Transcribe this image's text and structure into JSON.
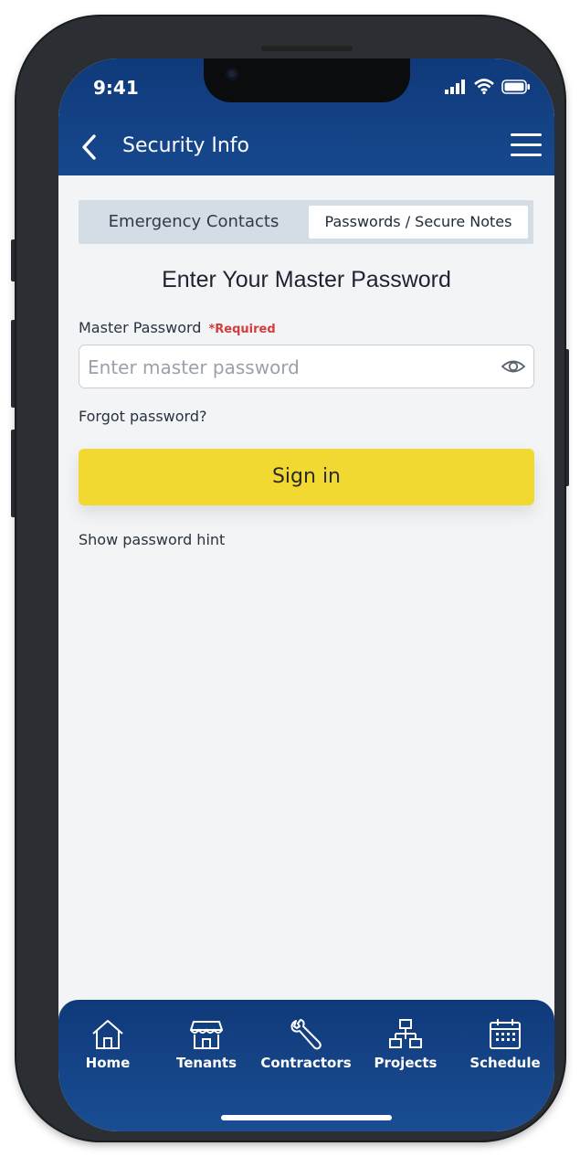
{
  "status": {
    "time": "9:41"
  },
  "header": {
    "title": "Security Info"
  },
  "tabs": [
    {
      "label": "Emergency Contacts",
      "active": false
    },
    {
      "label": "Passwords / Secure Notes",
      "active": true
    }
  ],
  "form": {
    "title": "Enter Your Master Password",
    "field_label": "Master Password",
    "required_text": "*Required",
    "input_value": "",
    "input_placeholder": "Enter master password",
    "forgot_label": "Forgot password?",
    "signin_label": "Sign in",
    "hint_label": "Show password hint"
  },
  "nav": [
    {
      "label": "Home",
      "icon": "house-icon"
    },
    {
      "label": "Tenants",
      "icon": "storefront-icon"
    },
    {
      "label": "Contractors",
      "icon": "wrench-icon"
    },
    {
      "label": "Projects",
      "icon": "org-chart-icon"
    },
    {
      "label": "Schedule",
      "icon": "calendar-icon"
    }
  ],
  "colors": {
    "header_blue": "#0f3a7a",
    "accent_yellow": "#f2d931",
    "required_red": "#d63b3b"
  }
}
